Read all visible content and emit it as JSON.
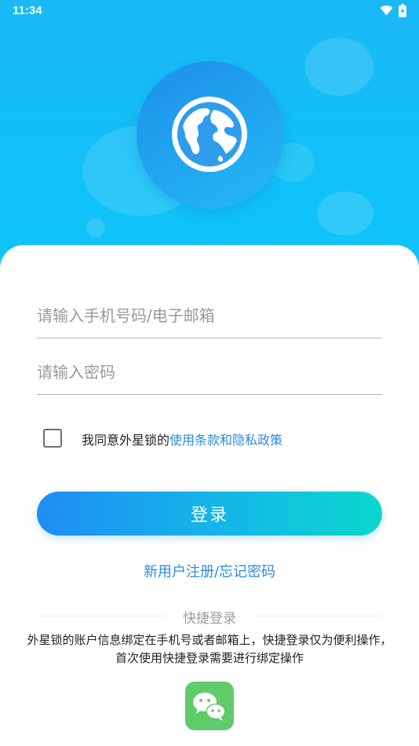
{
  "status_bar": {
    "time": "11:34",
    "icons": [
      "wifi-icon",
      "battery-charging-icon"
    ]
  },
  "hero": {
    "logo_icon": "globe-icon",
    "background_color": "#1bb8f5"
  },
  "form": {
    "phone_email": {
      "placeholder": "请输入手机号码/电子邮箱",
      "value": ""
    },
    "password": {
      "placeholder": "请输入密码",
      "value": ""
    },
    "agreement": {
      "checked": false,
      "text": "我同意外星锁的",
      "link_text": "使用条款和隐私政策"
    },
    "login_label": "登录",
    "register_forgot": "新用户注册/忘记密码"
  },
  "quick_login": {
    "title": "快捷登录",
    "description": "外星锁的账户信息绑定在手机号或者邮箱上，快捷登录仅为便利操作，首次使用快捷登录需要进行绑定操作",
    "wechat_icon": "wechat-icon"
  },
  "colors": {
    "accent": "#2a8be0",
    "button_gradient_start": "#1e8ef4",
    "button_gradient_end": "#0bd7cb",
    "wechat_green": "#5fcb6a"
  }
}
